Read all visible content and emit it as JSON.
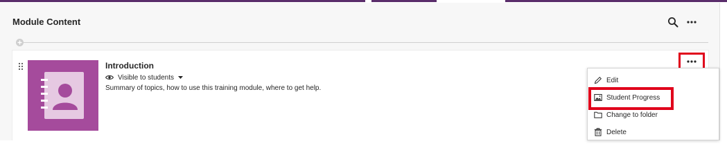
{
  "section": {
    "title": "Module Content"
  },
  "header_icons": {
    "search": "search-icon",
    "more": "more-horizontal-icon"
  },
  "item": {
    "title": "Introduction",
    "visibility_label": "Visible to students",
    "summary": "Summary of topics, how to use this training module, where to get help.",
    "thumbnail_icon": "notebook-person-icon",
    "thumbnail_color": "#a54b9c"
  },
  "context_menu": {
    "items": [
      {
        "label": "Edit",
        "icon": "pencil-icon"
      },
      {
        "label": "Student Progress",
        "icon": "image-icon"
      },
      {
        "label": "Change to folder",
        "icon": "folder-icon"
      },
      {
        "label": "Delete",
        "icon": "trash-icon"
      }
    ]
  },
  "colors": {
    "highlight": "#e0001b",
    "top_accent": "#5a2d6b"
  }
}
